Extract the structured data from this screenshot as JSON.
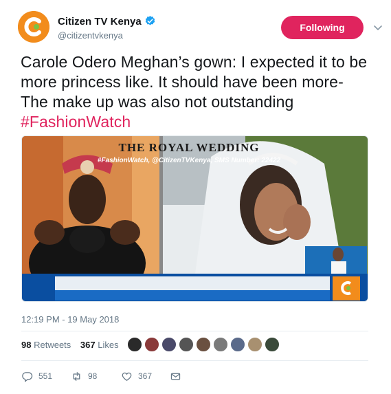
{
  "account": {
    "display_name": "Citizen TV Kenya",
    "handle": "@citizentvkenya",
    "verified_icon": "verified-badge-icon",
    "brand_color": "#f28c1c"
  },
  "follow_button": {
    "label": "Following",
    "color": "#e0245e"
  },
  "tweet": {
    "text": "Carole Odero Meghan’s gown: I expected it to be more princess like. It should have been more- The make up was also not outstanding",
    "hashtag": "#FashionWatch"
  },
  "media": {
    "banner_title": "THE ROYAL WEDDING",
    "banner_subtitle": "#FashionWatch, @CitizenTVKenya, SMS Number: 22422"
  },
  "timestamp": "12:19 PM - 19 May 2018",
  "stats": {
    "retweets_count": "98",
    "retweets_label": "Retweets",
    "likes_count": "367",
    "likes_label": "Likes"
  },
  "actions": {
    "replies": "551",
    "retweets": "98",
    "likes": "367"
  },
  "colors": {
    "text": "#14171a",
    "muted": "#657786",
    "accent": "#e0245e"
  }
}
